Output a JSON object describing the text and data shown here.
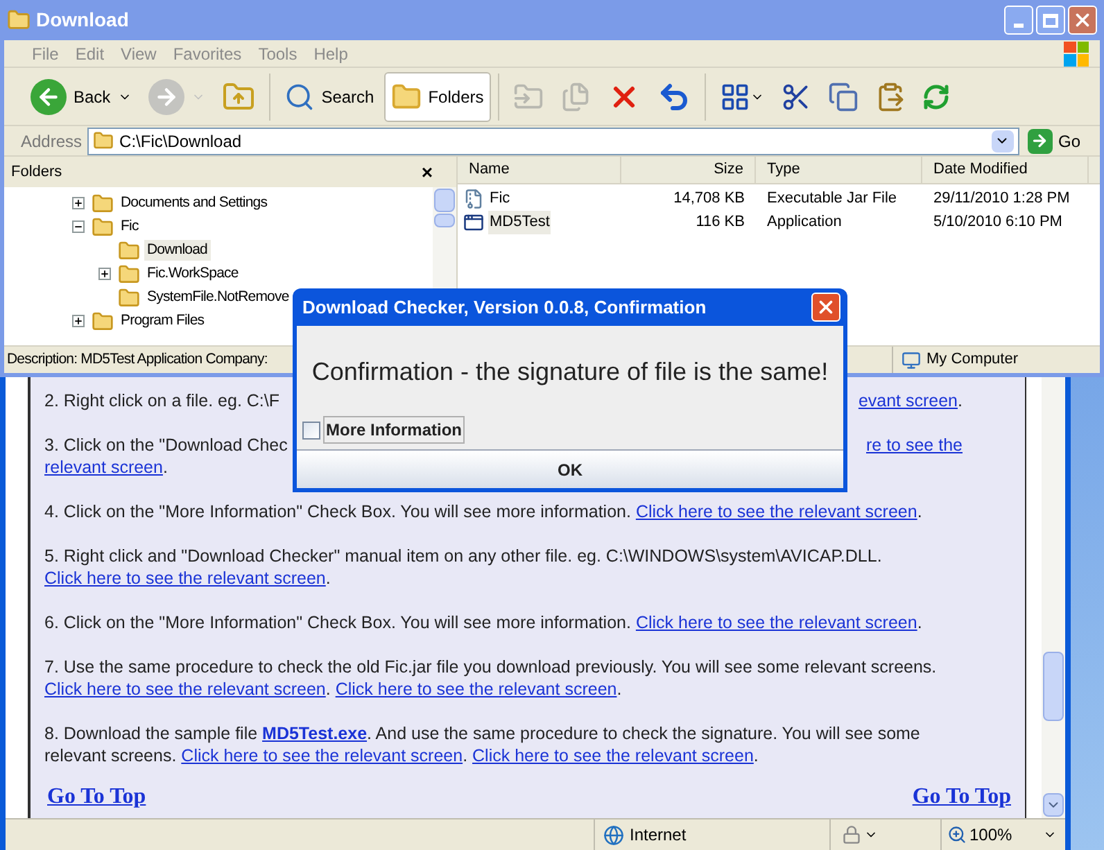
{
  "explorer": {
    "title": "Download",
    "menu": [
      "File",
      "Edit",
      "View",
      "Favorites",
      "Tools",
      "Help"
    ],
    "toolbar": [
      {
        "kind": "back",
        "label": "Back",
        "disabled": false,
        "pressed": false
      },
      {
        "kind": "forward",
        "disabled": true,
        "pressed": false
      },
      {
        "kind": "up",
        "disabled": false,
        "pressed": false
      },
      {
        "kind": "search",
        "label": "Search",
        "disabled": false,
        "pressed": false
      },
      {
        "kind": "folders",
        "label": "Folders",
        "disabled": false,
        "pressed": true
      },
      {
        "kind": "move",
        "disabled": true,
        "pressed": false
      },
      {
        "kind": "copyto",
        "disabled": true,
        "pressed": false
      },
      {
        "kind": "delete",
        "disabled": false,
        "pressed": false
      },
      {
        "kind": "undo",
        "disabled": false,
        "pressed": false
      },
      {
        "kind": "views",
        "disabled": false,
        "pressed": false
      },
      {
        "kind": "cut",
        "disabled": false,
        "pressed": false
      },
      {
        "kind": "copy",
        "disabled": false,
        "pressed": false
      },
      {
        "kind": "paste",
        "disabled": false,
        "pressed": false
      },
      {
        "kind": "refresh",
        "disabled": false,
        "pressed": false
      }
    ],
    "address": {
      "label": "Address",
      "value": "C:\\Fic\\Download",
      "go": "Go"
    },
    "folders_pane": {
      "title": "Folders",
      "close": "×",
      "tree": [
        {
          "label": "Documents and Settings",
          "expanded": false,
          "selected": false
        },
        {
          "label": "Fic",
          "expanded": true,
          "selected": false,
          "children": [
            {
              "label": "Download",
              "selected": true
            },
            {
              "label": "Fic.WorkSpace",
              "expanded": false,
              "selected": false
            },
            {
              "label": "SystemFile.NotRemove",
              "selected": false
            }
          ]
        },
        {
          "label": "Program Files",
          "expanded": false,
          "selected": false
        }
      ]
    },
    "file_list": {
      "columns": [
        "Name",
        "Size",
        "Type",
        "Date Modified"
      ],
      "rows": [
        {
          "kind": "jar",
          "name": "Fic",
          "size": "14,708 KB",
          "type": "Executable Jar File",
          "date": "29/11/2010 1:28 PM",
          "selected": false
        },
        {
          "kind": "app",
          "name": "MD5Test",
          "size": "116 KB",
          "type": "Application",
          "date": "5/10/2010 6:10 PM",
          "selected": true
        }
      ]
    },
    "status_bar": {
      "description": "Description: MD5Test Application Company:",
      "location": "My Computer"
    }
  },
  "dialog": {
    "title": "Download Checker, Version 0.0.8, Confirmation",
    "message": "Confirmation - the signature of file is the same!",
    "checkbox": {
      "label": "More Information",
      "checked": false
    },
    "button": "OK"
  },
  "browser_page": {
    "steps": [
      {
        "kind": "covered",
        "left": "2. Right click on a file. eg. C:\\F",
        "right": [
          {
            "kind": "link",
            "text": "evant screen"
          },
          {
            "kind": "text",
            "text": "."
          }
        ]
      },
      {
        "kind": "covered",
        "left": "3. Click on the \"Download Chec",
        "right": [
          {
            "kind": "link",
            "text": "re to see the"
          }
        ],
        "next_line": [
          {
            "kind": "link",
            "text": "relevant screen"
          },
          {
            "kind": "text",
            "text": "."
          }
        ]
      },
      {
        "kind": "full",
        "segments": [
          {
            "kind": "text",
            "text": "4. Click on the \"More Information\" Check Box. You will see more information. "
          },
          {
            "kind": "link",
            "text": "Click here to see the relevant screen"
          },
          {
            "kind": "text",
            "text": "."
          }
        ]
      },
      {
        "kind": "full",
        "segments": [
          {
            "kind": "text",
            "text": "5. Right click and \"Download Checker\" manual item on any other file. eg. C:\\WINDOWS\\system\\AVICAP.DLL. "
          },
          {
            "kind": "link",
            "text": "Click here to see the relevant screen"
          },
          {
            "kind": "text",
            "text": "."
          }
        ]
      },
      {
        "kind": "full",
        "segments": [
          {
            "kind": "text",
            "text": "6. Click on the \"More Information\" Check Box. You will see more information. "
          },
          {
            "kind": "link",
            "text": "Click here to see the relevant screen"
          },
          {
            "kind": "text",
            "text": "."
          }
        ]
      },
      {
        "kind": "full",
        "segments": [
          {
            "kind": "text",
            "text": "7. Use the same procedure to check the old Fic.jar file you download previously. You will see some relevant screens. "
          },
          {
            "kind": "link",
            "text": "Click here to see the relevant screen"
          },
          {
            "kind": "text",
            "text": ". "
          },
          {
            "kind": "link",
            "text": "Click here to see the relevant screen"
          },
          {
            "kind": "text",
            "text": "."
          }
        ]
      },
      {
        "kind": "full",
        "segments": [
          {
            "kind": "text",
            "text": "8. Download the sample file "
          },
          {
            "kind": "strong_link",
            "text": "MD5Test.exe"
          },
          {
            "kind": "text",
            "text": ". And use the same procedure to check the signature. You will see some relevant screens. "
          },
          {
            "kind": "link",
            "text": "Click here to see the relevant screen"
          },
          {
            "kind": "text",
            "text": ". "
          },
          {
            "kind": "link",
            "text": "Click here to see the relevant screen"
          },
          {
            "kind": "text",
            "text": "."
          }
        ]
      }
    ],
    "go_to_top": [
      "Go To Top",
      "Go To Top"
    ]
  },
  "browser_status": {
    "zone": "Internet",
    "zoom": "100%"
  }
}
